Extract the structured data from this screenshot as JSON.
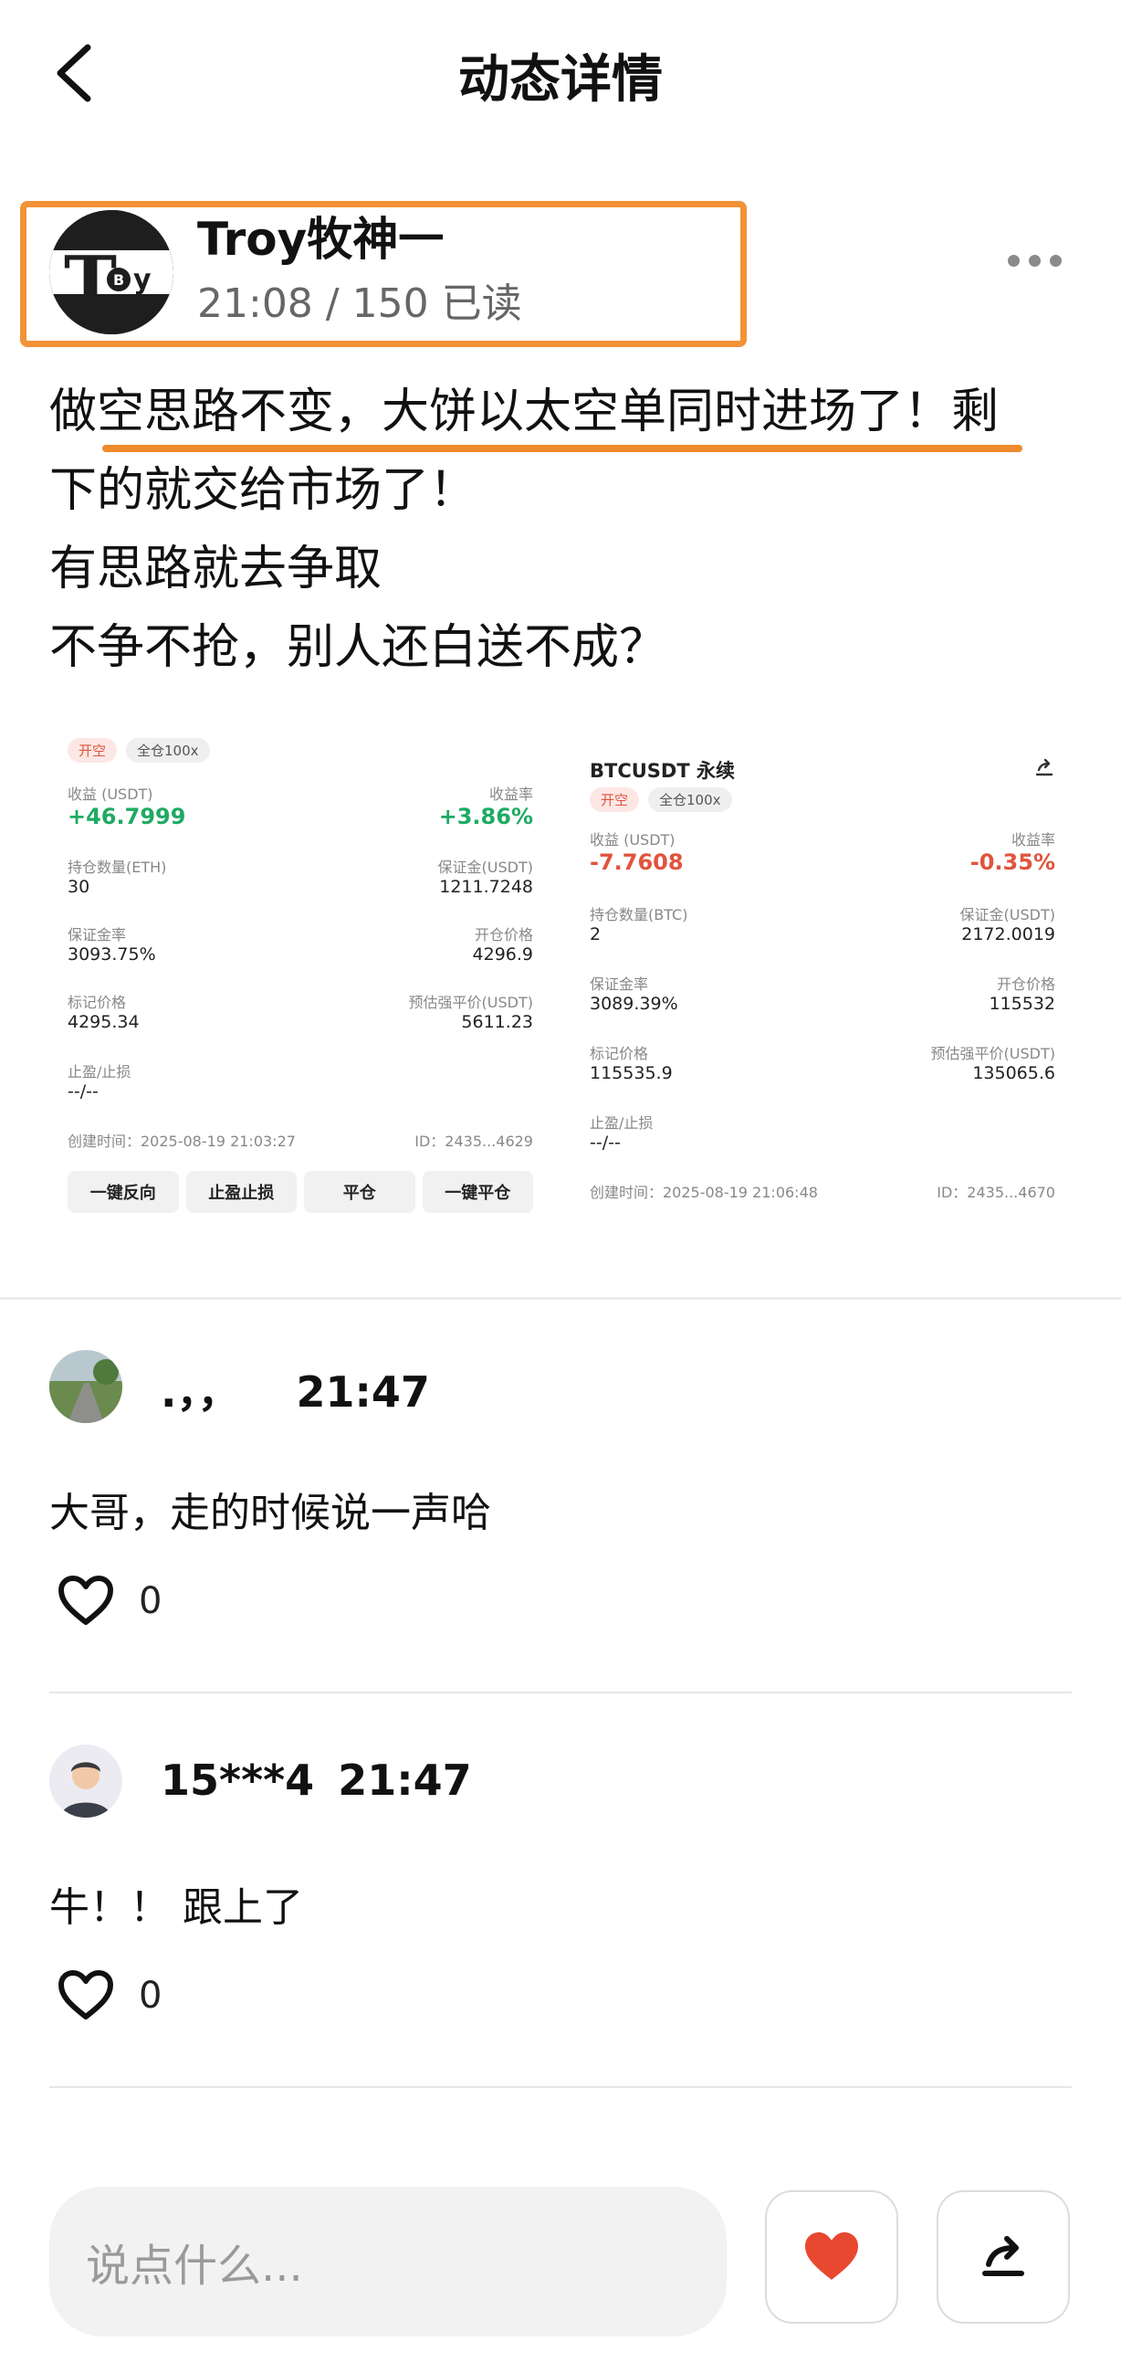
{
  "header": {
    "title": "动态详情"
  },
  "author": {
    "avatar_text": "Troy",
    "name": "Troy牧神一",
    "meta": "21:08 / 150 已读"
  },
  "post": {
    "lines": [
      "做空思路不变，大饼以太空单同时进场了！剩",
      "下的就交给市场了！",
      "有思路就去争取",
      "不争不抢，别人还白送不成？"
    ]
  },
  "screenshots": [
    {
      "title": "",
      "tags": [
        "开空",
        "全仓100x"
      ],
      "pnl_label": "收益 (USDT)",
      "pnl": "+46.7999",
      "roi_label": "收益率",
      "roi": "+3.86%",
      "qty_label": "持仓数量(ETH)",
      "qty": "30",
      "margin_label": "保证金(USDT)",
      "margin": "1211.7248",
      "ratio_label": "保证金率",
      "ratio": "3093.75%",
      "open_label": "开仓价格",
      "open": "4296.9",
      "mark_label": "标记价格",
      "mark": "4295.34",
      "liq_label": "预估强平价(USDT)",
      "liq": "5611.23",
      "tpsl_label": "止盈/止损",
      "tpsl": "--/--",
      "created": "创建时间：2025-08-19 21:03:27",
      "id": "ID：2435...4629",
      "buttons": [
        "一键反向",
        "止盈止损",
        "平仓",
        "一键平仓"
      ]
    },
    {
      "title": "BTCUSDT 永续",
      "tags": [
        "开空",
        "全仓100x"
      ],
      "pnl_label": "收益 (USDT)",
      "pnl": "-7.7608",
      "roi_label": "收益率",
      "roi": "-0.35%",
      "qty_label": "持仓数量(BTC)",
      "qty": "2",
      "margin_label": "保证金(USDT)",
      "margin": "2172.0019",
      "ratio_label": "保证金率",
      "ratio": "3089.39%",
      "open_label": "开仓价格",
      "open": "115532",
      "mark_label": "标记价格",
      "mark": "115535.9",
      "liq_label": "预估强平价(USDT)",
      "liq": "135065.6",
      "tpsl_label": "止盈/止损",
      "tpsl": "--/--",
      "created": "创建时间：2025-08-19 21:06:48",
      "id": "ID：2435...4670"
    }
  ],
  "comments": [
    {
      "name": ".，，",
      "time": "21:47",
      "text": "大哥，走的时候说一声哈",
      "likes": "0"
    },
    {
      "name": "15***4",
      "time": "21:47",
      "text": "牛！！ 跟上了",
      "likes": "0"
    }
  ],
  "footer": {
    "placeholder": "说点什么..."
  },
  "colors": {
    "accent": "#f39237",
    "heart": "#e8482f",
    "gain": "#1faa63",
    "loss": "#e0543d"
  }
}
